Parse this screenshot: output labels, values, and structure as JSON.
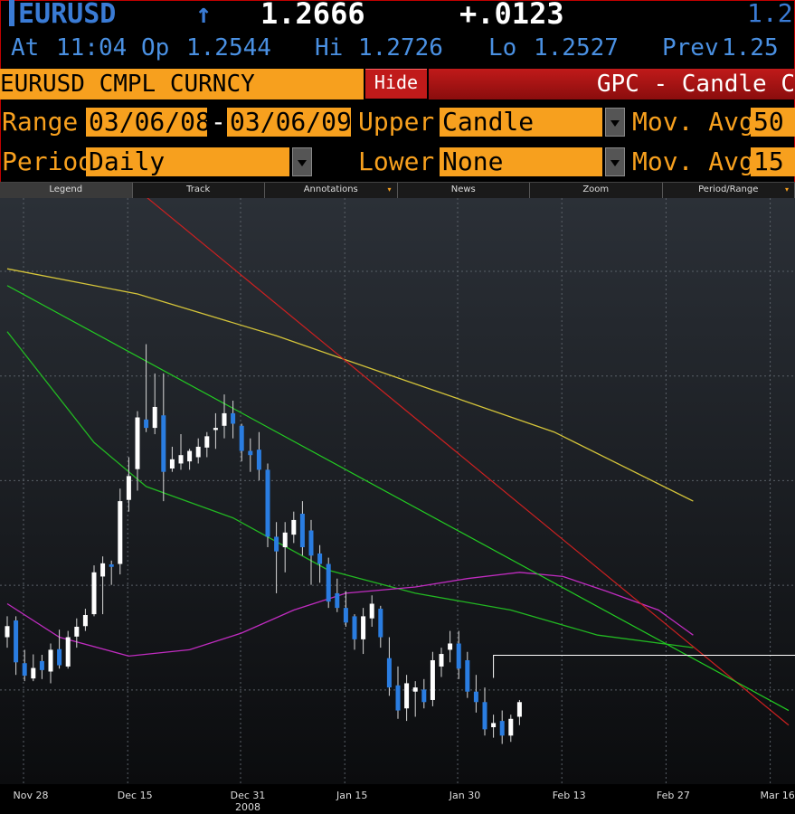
{
  "header": {
    "ticker": "EURUSD",
    "arrow": "↑",
    "last": "1.2666",
    "change": "+.0123",
    "last_repeat": "1.2",
    "at_label": "At",
    "at_time": "11:04",
    "op_label": "Op",
    "op_value": "1.2544",
    "hi_label": "Hi",
    "hi_value": "1.2726",
    "lo_label": "Lo",
    "lo_value": "1.2527",
    "prev_label": "Prev",
    "prev_value": "1.25"
  },
  "security_bar": {
    "security": "EURUSD CMPL CURNCY",
    "hide_label": "Hide",
    "function_title": "GPC - Candle C"
  },
  "controls": {
    "range_label": "Range",
    "range_start": "03/06/08",
    "range_sep": "-",
    "range_end": "03/06/09",
    "upper_label": "Upper",
    "upper_value": "Candle Chart",
    "movavgs_label": "Mov. Avgs",
    "movavgs_value": "50",
    "period_label": "Period",
    "period_value": "Daily",
    "lower_label": "Lower",
    "lower_value": "None",
    "movavg_label": "Mov. Avg",
    "movavg_value": "15"
  },
  "toolbar": {
    "tabs": [
      "Legend",
      "Track",
      "Annotations",
      "News",
      "Zoom",
      "Period/Range"
    ],
    "dropdown_tabs": [
      false,
      false,
      true,
      false,
      false,
      true
    ]
  },
  "colors": {
    "accent": "#f7a01e",
    "up_candle": "#ffffff",
    "down_candle": "#2a7de1",
    "mavg_yellow": "#d4c43a",
    "mavg_green": "#22b822",
    "mavg_magenta": "#c02cc0",
    "trend_red": "#cc2020",
    "trend_green": "#22cc22",
    "marker_line": "#ffffff"
  },
  "chart_data": {
    "type": "candlestick",
    "period": "Daily",
    "x_tick_labels": [
      "Nov 28",
      "Dec 15",
      "Dec 31",
      "Jan 15",
      "Jan 30",
      "Feb 13",
      "Feb 27",
      "Mar 16"
    ],
    "x_year_label": "2008",
    "ylim": [
      1.205,
      1.485
    ],
    "grid": true,
    "candles": [
      {
        "o": 1.2752,
        "h": 1.2852,
        "l": 1.2702,
        "c": 1.2805
      },
      {
        "o": 1.2832,
        "h": 1.2852,
        "l": 1.2572,
        "c": 1.2632
      },
      {
        "o": 1.2628,
        "h": 1.2692,
        "l": 1.2542,
        "c": 1.2568
      },
      {
        "o": 1.2555,
        "h": 1.267,
        "l": 1.2542,
        "c": 1.2605
      },
      {
        "o": 1.2638,
        "h": 1.2668,
        "l": 1.2552,
        "c": 1.2595
      },
      {
        "o": 1.2588,
        "h": 1.2722,
        "l": 1.2532,
        "c": 1.2692
      },
      {
        "o": 1.2695,
        "h": 1.2788,
        "l": 1.2602,
        "c": 1.2618
      },
      {
        "o": 1.2612,
        "h": 1.2782,
        "l": 1.2602,
        "c": 1.2752
      },
      {
        "o": 1.2755,
        "h": 1.2842,
        "l": 1.2702,
        "c": 1.2802
      },
      {
        "o": 1.2805,
        "h": 1.2888,
        "l": 1.2782,
        "c": 1.2858
      },
      {
        "o": 1.2862,
        "h": 1.3095,
        "l": 1.2852,
        "c": 1.3062
      },
      {
        "o": 1.3042,
        "h": 1.3138,
        "l": 1.2862,
        "c": 1.3105
      },
      {
        "o": 1.31,
        "h": 1.3118,
        "l": 1.3002,
        "c": 1.3088
      },
      {
        "o": 1.3102,
        "h": 1.3462,
        "l": 1.3052,
        "c": 1.3402
      },
      {
        "o": 1.3408,
        "h": 1.3612,
        "l": 1.3352,
        "c": 1.3522
      },
      {
        "o": 1.3555,
        "h": 1.3832,
        "l": 1.3452,
        "c": 1.3802
      },
      {
        "o": 1.3792,
        "h": 1.4152,
        "l": 1.3732,
        "c": 1.3752
      },
      {
        "o": 1.3752,
        "h": 1.4012,
        "l": 1.3722,
        "c": 1.3852
      },
      {
        "o": 1.3812,
        "h": 1.4012,
        "l": 1.3402,
        "c": 1.3542
      },
      {
        "o": 1.3558,
        "h": 1.3662,
        "l": 1.3542,
        "c": 1.3602
      },
      {
        "o": 1.3582,
        "h": 1.3722,
        "l": 1.3552,
        "c": 1.3622
      },
      {
        "o": 1.3592,
        "h": 1.3652,
        "l": 1.3552,
        "c": 1.3642
      },
      {
        "o": 1.3612,
        "h": 1.3702,
        "l": 1.3582,
        "c": 1.3662
      },
      {
        "o": 1.3658,
        "h": 1.3732,
        "l": 1.3612,
        "c": 1.3712
      },
      {
        "o": 1.3742,
        "h": 1.3822,
        "l": 1.3652,
        "c": 1.3752
      },
      {
        "o": 1.3762,
        "h": 1.3912,
        "l": 1.3702,
        "c": 1.3822
      },
      {
        "o": 1.3822,
        "h": 1.3882,
        "l": 1.3702,
        "c": 1.3772
      },
      {
        "o": 1.3762,
        "h": 1.3772,
        "l": 1.3592,
        "c": 1.3642
      },
      {
        "o": 1.3642,
        "h": 1.3702,
        "l": 1.3542,
        "c": 1.3622
      },
      {
        "o": 1.3648,
        "h": 1.3732,
        "l": 1.3502,
        "c": 1.3552
      },
      {
        "o": 1.3552,
        "h": 1.3582,
        "l": 1.3182,
        "c": 1.3232
      },
      {
        "o": 1.3232,
        "h": 1.3302,
        "l": 1.2962,
        "c": 1.3162
      },
      {
        "o": 1.3182,
        "h": 1.3302,
        "l": 1.3062,
        "c": 1.3252
      },
      {
        "o": 1.3242,
        "h": 1.3352,
        "l": 1.3202,
        "c": 1.3312
      },
      {
        "o": 1.3342,
        "h": 1.3402,
        "l": 1.3142,
        "c": 1.3182
      },
      {
        "o": 1.3262,
        "h": 1.3312,
        "l": 1.3002,
        "c": 1.3142
      },
      {
        "o": 1.3152,
        "h": 1.3192,
        "l": 1.3012,
        "c": 1.3102
      },
      {
        "o": 1.3102,
        "h": 1.3132,
        "l": 1.2892,
        "c": 1.2922
      },
      {
        "o": 1.2962,
        "h": 1.3032,
        "l": 1.2872,
        "c": 1.2892
      },
      {
        "o": 1.2892,
        "h": 1.2972,
        "l": 1.2802,
        "c": 1.2822
      },
      {
        "o": 1.2852,
        "h": 1.2862,
        "l": 1.2692,
        "c": 1.2742
      },
      {
        "o": 1.2742,
        "h": 1.2892,
        "l": 1.2672,
        "c": 1.2852
      },
      {
        "o": 1.2842,
        "h": 1.2952,
        "l": 1.2802,
        "c": 1.2912
      },
      {
        "o": 1.2888,
        "h": 1.2902,
        "l": 1.2702,
        "c": 1.2752
      },
      {
        "o": 1.2652,
        "h": 1.2752,
        "l": 1.2472,
        "c": 1.2512
      },
      {
        "o": 1.2522,
        "h": 1.2612,
        "l": 1.2362,
        "c": 1.2402
      },
      {
        "o": 1.2412,
        "h": 1.2572,
        "l": 1.2352,
        "c": 1.2532
      },
      {
        "o": 1.2492,
        "h": 1.2542,
        "l": 1.2372,
        "c": 1.2512
      },
      {
        "o": 1.2502,
        "h": 1.2552,
        "l": 1.2412,
        "c": 1.2442
      },
      {
        "o": 1.2452,
        "h": 1.2682,
        "l": 1.2422,
        "c": 1.2642
      },
      {
        "o": 1.2612,
        "h": 1.2702,
        "l": 1.2562,
        "c": 1.2672
      },
      {
        "o": 1.2692,
        "h": 1.2782,
        "l": 1.2632,
        "c": 1.2722
      },
      {
        "o": 1.2722,
        "h": 1.2782,
        "l": 1.2552,
        "c": 1.2602
      },
      {
        "o": 1.2642,
        "h": 1.2682,
        "l": 1.2462,
        "c": 1.2492
      },
      {
        "o": 1.2492,
        "h": 1.2572,
        "l": 1.2392,
        "c": 1.2442
      },
      {
        "o": 1.2442,
        "h": 1.2512,
        "l": 1.2282,
        "c": 1.2312
      },
      {
        "o": 1.2322,
        "h": 1.2382,
        "l": 1.2272,
        "c": 1.2342
      },
      {
        "o": 1.2352,
        "h": 1.2402,
        "l": 1.2242,
        "c": 1.2282
      },
      {
        "o": 1.2282,
        "h": 1.2382,
        "l": 1.2252,
        "c": 1.2362
      },
      {
        "o": 1.2372,
        "h": 1.2452,
        "l": 1.2332,
        "c": 1.2442
      }
    ],
    "moving_averages": [
      {
        "color": "yellow",
        "points": [
          [
            0,
            1.4512
          ],
          [
            15,
            1.4392
          ],
          [
            31,
            1.4192
          ],
          [
            47,
            1.3962
          ],
          [
            63,
            1.3732
          ],
          [
            79,
            1.3402
          ]
        ]
      },
      {
        "color": "green",
        "points": [
          [
            0,
            1.4212
          ],
          [
            10,
            1.3682
          ],
          [
            16,
            1.3472
          ],
          [
            26,
            1.3322
          ],
          [
            37,
            1.3072
          ],
          [
            47,
            1.2962
          ],
          [
            58,
            1.2882
          ],
          [
            68,
            1.2762
          ],
          [
            79,
            1.2702
          ]
        ]
      },
      {
        "color": "magenta",
        "points": [
          [
            0,
            1.2912
          ],
          [
            6,
            1.2752
          ],
          [
            14,
            1.2662
          ],
          [
            21,
            1.2692
          ],
          [
            27,
            1.2772
          ],
          [
            33,
            1.2882
          ],
          [
            39,
            1.2962
          ],
          [
            47,
            1.2992
          ],
          [
            53,
            1.3032
          ],
          [
            59,
            1.3062
          ],
          [
            64,
            1.3042
          ],
          [
            69,
            1.2972
          ],
          [
            75,
            1.2882
          ],
          [
            79,
            1.2762
          ]
        ]
      }
    ],
    "trendlines": [
      {
        "color": "red",
        "from": [
          12,
          1.4992
        ],
        "to": [
          90,
          1.2332
        ]
      },
      {
        "color": "green",
        "from": [
          0,
          1.4432
        ],
        "to": [
          90,
          1.2402
        ]
      }
    ],
    "marker_level": 1.2666
  }
}
